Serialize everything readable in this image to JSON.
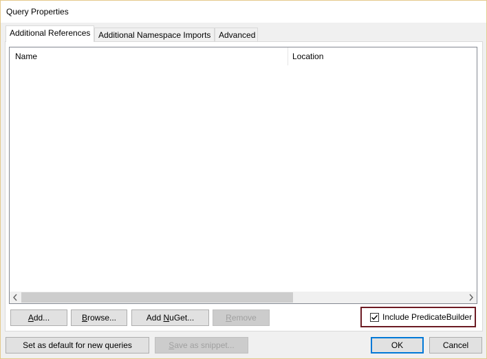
{
  "window": {
    "title": "Query Properties"
  },
  "tabs": [
    {
      "label": "Additional References",
      "active": true
    },
    {
      "label": "Additional Namespace Imports",
      "active": false
    },
    {
      "label": "Advanced",
      "active": false
    }
  ],
  "list": {
    "columns": [
      "Name",
      "Location"
    ],
    "rows": []
  },
  "buttons": {
    "add": {
      "pre": "",
      "u": "A",
      "post": "dd..."
    },
    "browse": {
      "pre": "",
      "u": "B",
      "post": "rowse..."
    },
    "add_nuget": {
      "pre": "Add ",
      "u": "N",
      "post": "uGet..."
    },
    "remove": {
      "pre": "",
      "u": "R",
      "post": "emove"
    },
    "set_default": "Set as default for new queries",
    "save_snippet": {
      "pre": "",
      "u": "S",
      "post": "ave as snippet..."
    },
    "ok": "OK",
    "cancel": "Cancel"
  },
  "include_predicatebuilder": {
    "label": "Include PredicateBuilder",
    "checked": true
  },
  "icons": {
    "scroll_left": "chevron-left-icon",
    "scroll_right": "chevron-right-icon",
    "check": "checkmark-icon"
  }
}
